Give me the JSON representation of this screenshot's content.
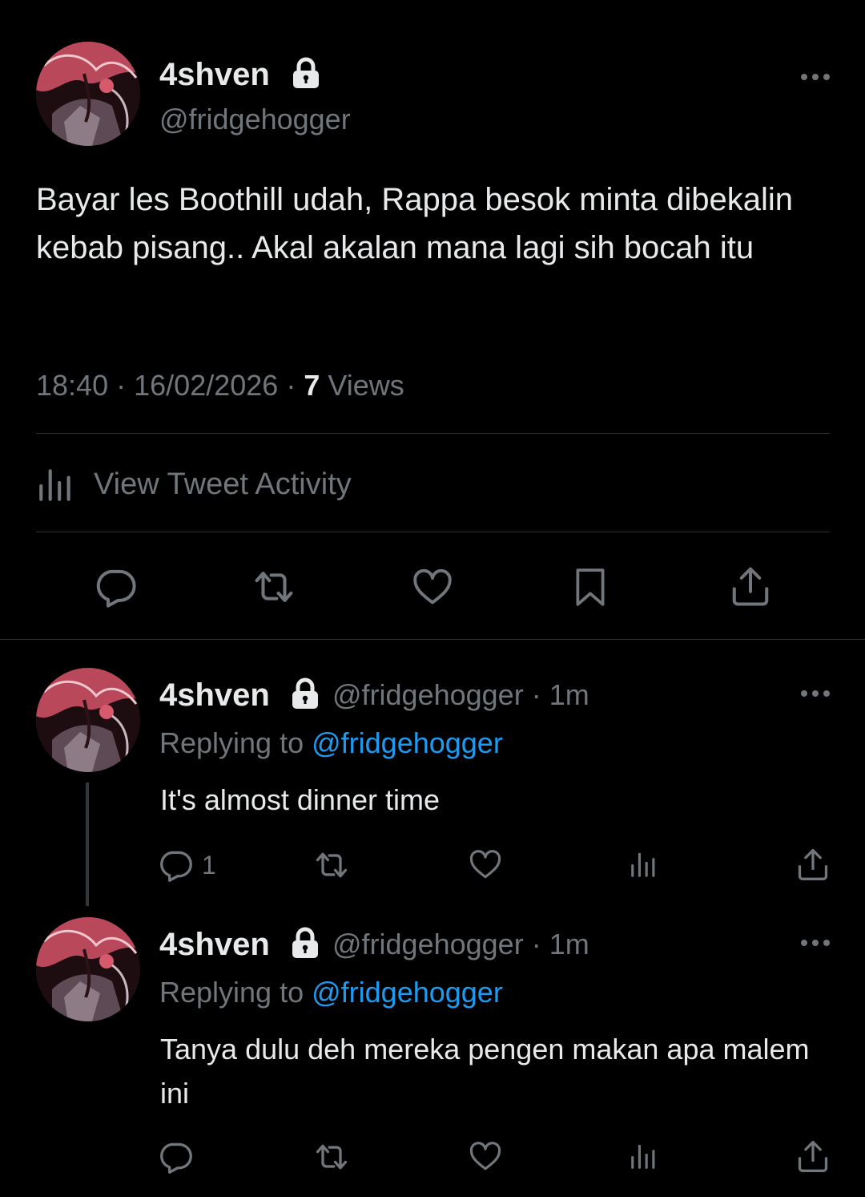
{
  "main_tweet": {
    "display_name": "4shven",
    "handle": "@fridgehogger",
    "text": "Bayar les Boothill udah, Rappa besok minta dibekalin kebab pisang.. Akal akalan mana lagi sih bocah itu",
    "time": "18:40",
    "date": "16/02/2026",
    "views_count": "7",
    "views_label": "Views",
    "separator": "·",
    "activity_label": "View Tweet Activity"
  },
  "replies": [
    {
      "display_name": "4shven",
      "handle": "@fridgehogger",
      "age": "· 1m",
      "replying_label": "Replying to",
      "replying_mention": "@fridgehogger",
      "text": "It's almost dinner time",
      "reply_count": "1"
    },
    {
      "display_name": "4shven",
      "handle": "@fridgehogger",
      "age": "· 1m",
      "replying_label": "Replying to",
      "replying_mention": "@fridgehogger",
      "text": "Tanya dulu deh mereka pengen makan apa malem ini",
      "reply_count": ""
    }
  ],
  "icons": {
    "lock": "lock-icon",
    "more": "more-icon",
    "reply": "reply-icon",
    "retweet": "retweet-icon",
    "like": "heart-icon",
    "bookmark": "bookmark-icon",
    "share": "share-icon",
    "analytics": "analytics-icon"
  },
  "colors": {
    "background": "#000000",
    "text": "#e7e9ea",
    "secondary": "#71767b",
    "accent": "#1d9bf0",
    "divider": "#2f3336"
  }
}
